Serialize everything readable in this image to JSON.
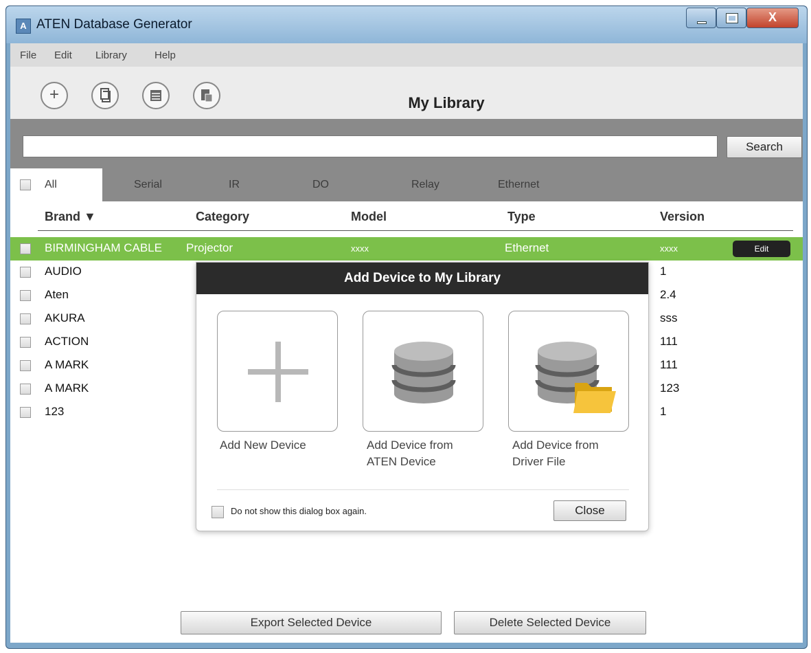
{
  "window": {
    "title": "ATEN Database Generator",
    "close_glyph": "X"
  },
  "menu": [
    "File",
    "Edit",
    "Library",
    "Help"
  ],
  "toolbar": {
    "title": "My Library",
    "icons": [
      "add-icon",
      "copy-icon",
      "list-icon",
      "import-icon"
    ]
  },
  "search": {
    "value": "",
    "button_label": "Search"
  },
  "tabs": [
    "All",
    "Serial",
    "IR",
    "DO",
    "Relay",
    "Ethernet"
  ],
  "table": {
    "columns": [
      "Brand ▼",
      "Category",
      "Model",
      "Type",
      "Version"
    ],
    "rows": [
      {
        "brand": "BIRMINGHAM CABLE",
        "category": "Projector",
        "model": "xxxx",
        "type": "Ethernet",
        "version": "xxxx",
        "selected": true,
        "action": "Edit"
      },
      {
        "brand": "AUDIO",
        "version": "1"
      },
      {
        "brand": "Aten",
        "version": "2.4"
      },
      {
        "brand": "AKURA",
        "version": "sss"
      },
      {
        "brand": "ACTION",
        "version": "111"
      },
      {
        "brand": "A MARK",
        "version": "111"
      },
      {
        "brand": "A MARK",
        "version": "123"
      },
      {
        "brand": "123",
        "version": "1"
      }
    ]
  },
  "dialog": {
    "title": "Add Device to My Library",
    "options": [
      {
        "label_line1": "Add New Device",
        "label_line2": "",
        "icon": "plus-icon"
      },
      {
        "label_line1": "Add Device from",
        "label_line2": "ATEN Device",
        "icon": "database-icon"
      },
      {
        "label_line1": "Add Device from",
        "label_line2": "Driver File",
        "icon": "database-folder-icon"
      }
    ],
    "checkbox_label": "Do not show this dialog box again.",
    "close_label": "Close"
  },
  "actions": {
    "export_label": "Export Selected Device",
    "delete_label": "Delete Selected Device"
  },
  "colors": {
    "selected_row": "#7cc04a",
    "dialog_header": "#2b2b2b",
    "band": "#8a8a8a"
  }
}
